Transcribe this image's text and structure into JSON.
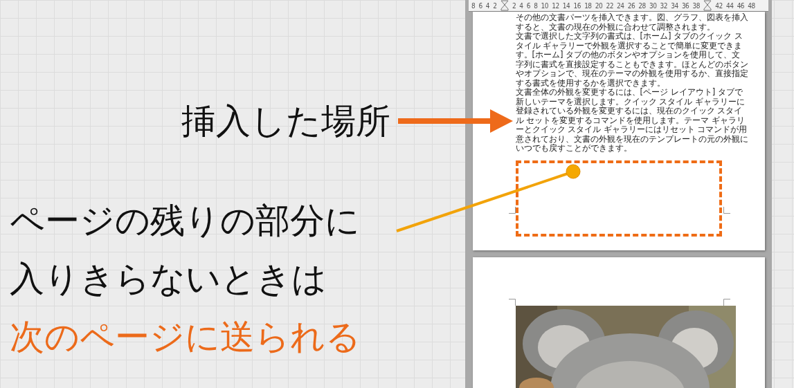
{
  "annotations": {
    "insert_label": "挿入した場所",
    "overflow_lines": [
      {
        "text": "ページの残りの部分に",
        "highlight": false
      },
      {
        "text": "入りきらないときは",
        "highlight": false
      },
      {
        "text": "次のページに送られる",
        "highlight": true
      }
    ]
  },
  "ruler": {
    "ticks": [
      {
        "kind": "number",
        "label": "8"
      },
      {
        "kind": "number",
        "label": "6"
      },
      {
        "kind": "number",
        "label": "4"
      },
      {
        "kind": "number",
        "label": "2"
      },
      {
        "kind": "marker"
      },
      {
        "kind": "number",
        "label": "2"
      },
      {
        "kind": "number",
        "label": "4"
      },
      {
        "kind": "number",
        "label": "6"
      },
      {
        "kind": "number",
        "label": "8"
      },
      {
        "kind": "number",
        "label": "10"
      },
      {
        "kind": "number",
        "label": "12"
      },
      {
        "kind": "number",
        "label": "14"
      },
      {
        "kind": "number",
        "label": "16"
      },
      {
        "kind": "number",
        "label": "18"
      },
      {
        "kind": "number",
        "label": "20"
      },
      {
        "kind": "number",
        "label": "22"
      },
      {
        "kind": "number",
        "label": "24"
      },
      {
        "kind": "number",
        "label": "26"
      },
      {
        "kind": "number",
        "label": "28"
      },
      {
        "kind": "number",
        "label": "30"
      },
      {
        "kind": "number",
        "label": "32"
      },
      {
        "kind": "number",
        "label": "34"
      },
      {
        "kind": "number",
        "label": "36"
      },
      {
        "kind": "number",
        "label": "38"
      },
      {
        "kind": "marker"
      },
      {
        "kind": "number",
        "label": "42"
      },
      {
        "kind": "number",
        "label": "44"
      },
      {
        "kind": "number",
        "label": "46"
      },
      {
        "kind": "number",
        "label": "48"
      }
    ]
  },
  "document": {
    "paragraphs": [
      "その他の文書パーツを挿入できます。図、グラフ、図表を挿入すると、文書の現在の外観に合わせて調整されます。",
      "文書で選択した文字列の書式は、[ホーム] タブのクイック スタイル ギャラリーで外観を選択することで簡単に変更できます。[ホーム] タブの他のボタンやオプションを使用して、文字列に書式を直接設定することもできます。ほとんどのボタンやオプションで、現在のテーマの外観を使用するか、直接指定する書式を使用するかを選択できます。",
      "文書全体の外観を変更するには、[ページ レイアウト] タブで新しいテーマを選択します。クイック スタイル ギャラリーに登録されている外観を変更するには、現在のクイック スタイル セットを変更するコマンドを使用します。テーマ ギャラリーとクイック スタイル ギャラリーにはリセット コマンドが用意されており、文書の外観を現在のテンプレートの元の外観にいつでも戻すことができます。"
    ]
  }
}
